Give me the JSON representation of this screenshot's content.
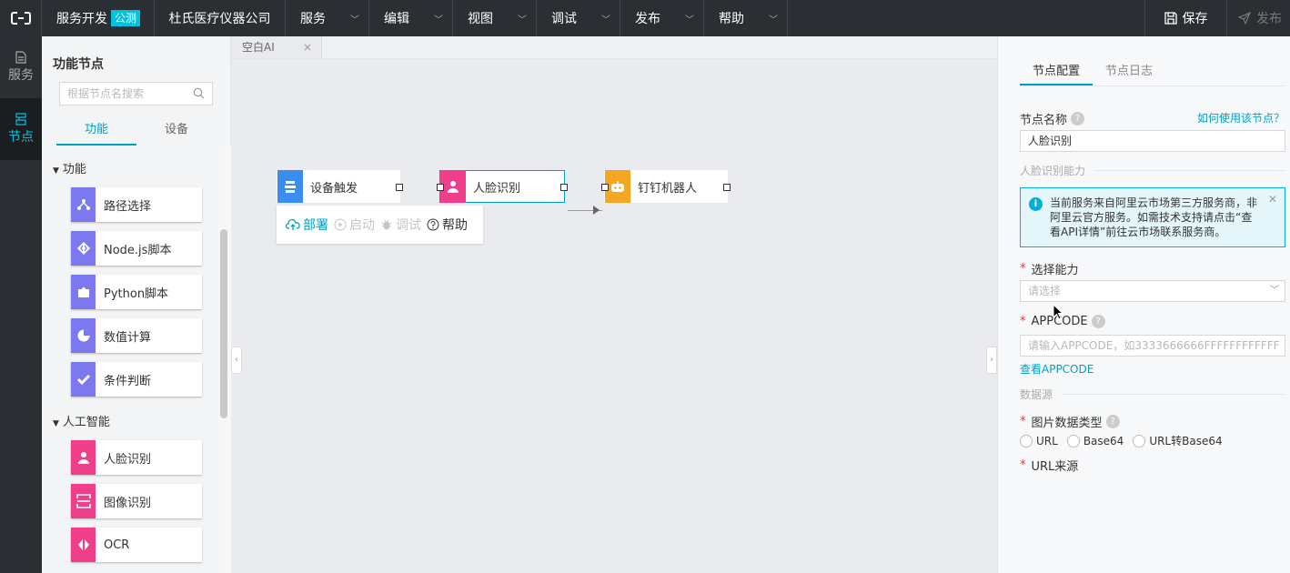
{
  "topbar": {
    "brand": "服务开发",
    "brand_tag": "公测",
    "company": "杜氏医疗仪器公司",
    "menus": [
      "服务",
      "编辑",
      "视图",
      "调试",
      "发布",
      "帮助"
    ],
    "save": "保存",
    "publish": "发布"
  },
  "rail": [
    {
      "label": "服务",
      "icon": "document-icon"
    },
    {
      "label": "节点",
      "icon": "nodes-icon"
    }
  ],
  "panel": {
    "title": "功能节点",
    "search_placeholder": "根据节点名搜索",
    "tabs": [
      "功能",
      "设备"
    ],
    "groups": [
      {
        "label": "功能",
        "items": [
          {
            "label": "路径选择",
            "icon": "route-icon",
            "color": "#7b78f0"
          },
          {
            "label": "Node.js脚本",
            "icon": "code-icon",
            "color": "#7b78f0"
          },
          {
            "label": "Python脚本",
            "icon": "puzzle-icon",
            "color": "#7b78f0"
          },
          {
            "label": "数值计算",
            "icon": "pie-icon",
            "color": "#7b78f0"
          },
          {
            "label": "条件判断",
            "icon": "check-icon",
            "color": "#7b78f0"
          }
        ]
      },
      {
        "label": "人工智能",
        "items": [
          {
            "label": "人脸识别",
            "icon": "face-icon",
            "color": "#ef3e8a"
          },
          {
            "label": "图像识别",
            "icon": "image-scan-icon",
            "color": "#ef3e8a"
          },
          {
            "label": "OCR",
            "icon": "ocr-icon",
            "color": "#ef3e8a"
          }
        ]
      }
    ]
  },
  "canvas": {
    "doc_tab": "空白AI",
    "nodes": [
      {
        "label": "设备触发",
        "icon": "device-trigger-icon",
        "color": "#3a8ef0"
      },
      {
        "label": "人脸识别",
        "icon": "face-icon",
        "color": "#ef3e8a"
      },
      {
        "label": "钉钉机器人",
        "icon": "robot-icon",
        "color": "#f5a623"
      }
    ],
    "toolbar": [
      "部署",
      "启动",
      "调试",
      "帮助"
    ]
  },
  "config": {
    "tabs": [
      "节点配置",
      "节点日志"
    ],
    "node_name_label": "节点名称",
    "how_to_link": "如何使用该节点？",
    "node_name_value": "人脸识别",
    "section_ability": "人脸识别能力",
    "notice": "当前服务来自阿里云市场第三方服务商，非阿里云官方服务。如需技术支持请点击“查看API详情”前往云市场联系服务商。",
    "choose_label": "选择能力",
    "choose_placeholder": "请选择",
    "appcode_label": "APPCODE",
    "appcode_placeholder": "请输入APPCODE，如3333666666FFFFFFFFFFFF",
    "appcode_link": "查看APPCODE",
    "section_source": "数据源",
    "image_type_label": "图片数据类型",
    "image_types": [
      "URL",
      "Base64",
      "URL转Base64"
    ],
    "url_source_label": "URL来源"
  },
  "colors": {
    "accent": "#00a0c6",
    "topbar": "#2b2f33",
    "required": "#e4393c"
  }
}
